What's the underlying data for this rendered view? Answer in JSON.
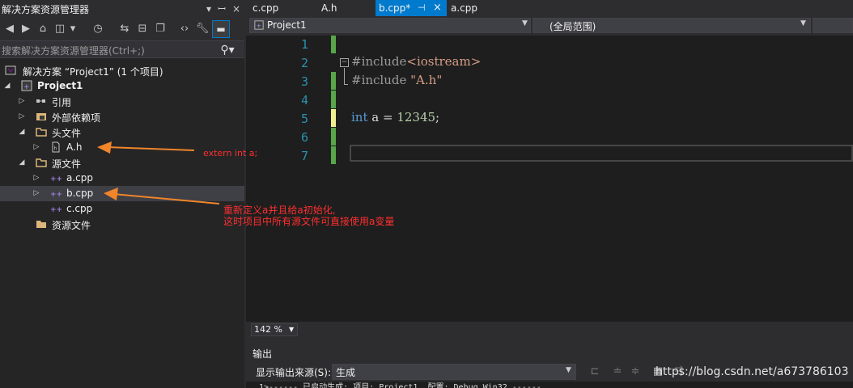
{
  "solution_explorer": {
    "title": "解决方案资源管理器",
    "search_placeholder": "搜索解决方案资源管理器(Ctrl+;)",
    "tree": [
      {
        "label": "解决方案 “Project1” (1 个项目)",
        "icon": "solution-icon"
      },
      {
        "label": "Project1",
        "icon": "project-icon",
        "expanded": true
      },
      {
        "label": "引用",
        "icon": "references-icon"
      },
      {
        "label": "外部依赖项",
        "icon": "external-deps-icon"
      },
      {
        "label": "头文件",
        "icon": "folder-icon",
        "expanded": true
      },
      {
        "label": "A.h",
        "icon": "header-file-icon"
      },
      {
        "label": "源文件",
        "icon": "folder-icon",
        "expanded": true
      },
      {
        "label": "a.cpp",
        "icon": "cpp-file-icon"
      },
      {
        "label": "b.cpp",
        "icon": "cpp-file-icon",
        "selected": true
      },
      {
        "label": "c.cpp",
        "icon": "cpp-file-icon"
      },
      {
        "label": "资源文件",
        "icon": "folder-icon"
      }
    ]
  },
  "tabs": [
    {
      "label": "c.cpp",
      "active": false
    },
    {
      "label": "A.h",
      "active": false
    },
    {
      "label": "b.cpp*",
      "active": true
    },
    {
      "label": "a.cpp",
      "active": false
    }
  ],
  "navbar": {
    "project": "Project1",
    "scope": "(全局范围)"
  },
  "editor": {
    "line_numbers": [
      "1",
      "2",
      "3",
      "4",
      "5",
      "6",
      "7"
    ],
    "line2_directive": "#include",
    "line2_arg": "<iostream>",
    "line3_directive": "#include",
    "line3_arg": "\"A.h\"",
    "line5_keyword": "int",
    "line5_rest": " a = ",
    "line5_number": "12345",
    "line5_end": ";",
    "zoom": "142 %"
  },
  "output": {
    "title": "输出",
    "source_label": "显示输出来源(S):",
    "source_value": "生成",
    "log_line": "1>------ 已启动生成: 项目: Project1, 配置: Debug Win32 ------"
  },
  "annotations": {
    "extern_note": "extern int a;",
    "redefine_line1": "重新定义a并且给a初始化,",
    "redefine_line2": "这时项目中所有源文件可直接使用a变量"
  },
  "watermark": "https://blog.csdn.net/a673786103",
  "colors": {
    "accent": "#007acc",
    "annotation": "#ff2f2f",
    "arrow": "#f0852a",
    "keyword": "#569cd6",
    "number": "#b5cea8",
    "string": "#d69d85",
    "directive": "#9b9b9b"
  }
}
